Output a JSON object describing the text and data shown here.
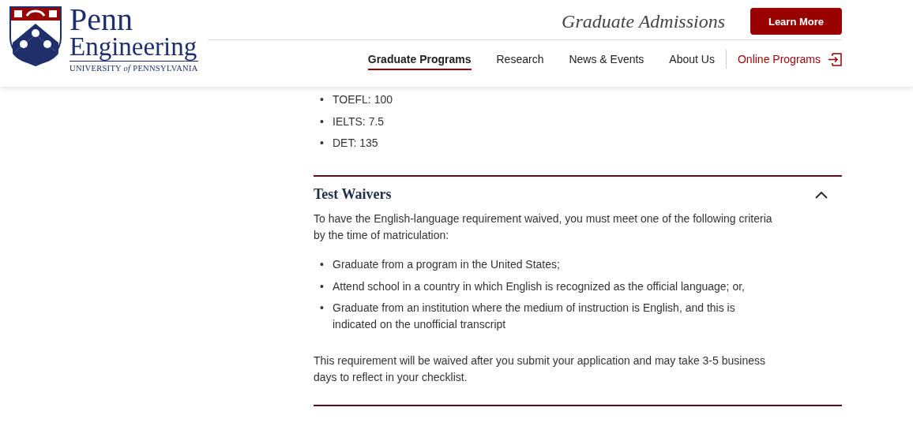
{
  "header": {
    "logo": {
      "name": "Penn",
      "subname": "Engineering",
      "university": "UNIVERSITY *of* PENNSYLVANIA"
    },
    "tagline": "Graduate Admissions",
    "cta": "Learn More",
    "nav": [
      {
        "label": "Graduate Programs",
        "selected": true,
        "kind": "link"
      },
      {
        "label": "Research",
        "selected": false,
        "kind": "link"
      },
      {
        "label": "News & Events",
        "selected": false,
        "kind": "link"
      },
      {
        "label": "About Us",
        "selected": false,
        "kind": "link"
      },
      {
        "label": "Online Programs",
        "selected": false,
        "kind": "external"
      }
    ]
  },
  "scores": [
    {
      "marker": "•",
      "text": "TOEFL: 100"
    },
    {
      "marker": "•",
      "text": "IELTS: 7.5"
    },
    {
      "marker": "•",
      "text": "DET: 135"
    }
  ],
  "section": {
    "title": "Test Waivers",
    "expanded": true,
    "intro": "To have the English-language requirement waived, you must meet one of the following criteria by the time of matriculation:",
    "criteria": [
      {
        "marker": "•",
        "text": "Graduate from a program in the United States;"
      },
      {
        "marker": "•",
        "text": "Attend school in a country in which English is recognized as the official language; or,"
      },
      {
        "marker": "•",
        "text": "Graduate from an institution where the medium of instruction is English, and this is indicated on the unofficial transcript"
      }
    ],
    "note": "This requirement will be waived after you submit your application and may take 3-5 business days to reflect in your checklist."
  }
}
